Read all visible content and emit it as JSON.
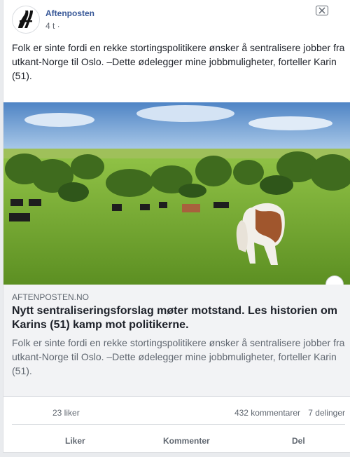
{
  "post": {
    "page_name": "Aftenposten",
    "time": "4 t ·",
    "text": "Folk er sinte fordi en rekke stortingspolitikere ønsker å sentralisere jobber fra utkant-Norge til Oslo. –Dette ødelegger mine jobbmuligheter, forteller Karin (51).",
    "close_icon": "close-x-icon",
    "avatar_logo": "aftenposten-logo"
  },
  "link": {
    "domain": "AFTENPOSTEN.NO",
    "title": "Nytt sentraliseringsforslag møter motstand. Les historien om Karins (51) kamp mot politikerne.",
    "description": "Folk er sinte fordi en rekke stortingspolitikere ønsker å sentralisere jobber fra utkant-Norge til Oslo. –Dette ødelegger mine jobbmuligheter, forteller Karin (51)."
  },
  "stats": {
    "likes": "23 liker",
    "comments": "432 kommentarer",
    "shares": "7 delinger"
  },
  "actions": {
    "like": "Liker",
    "comment": "Kommenter",
    "share": "Del"
  },
  "colors": {
    "page_name": "#385898",
    "link_background": "#f2f3f5",
    "text": "#1d2129",
    "muted": "#606770"
  }
}
